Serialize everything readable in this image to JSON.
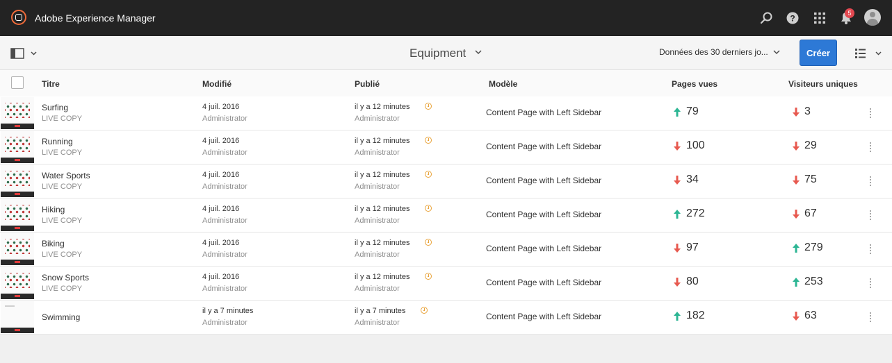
{
  "app": {
    "title": "Adobe Experience Manager",
    "notification_count": "5",
    "icons": [
      "aem-logo-icon",
      "search-icon",
      "help-icon",
      "apps-icon",
      "bell-icon",
      "avatar"
    ]
  },
  "toolbar": {
    "page_title": "Equipment",
    "date_range": "Données des 30 derniers jo...",
    "create_label": "Créer"
  },
  "columns": {
    "title": "Titre",
    "modified": "Modifié",
    "published": "Publié",
    "template": "Modèle",
    "page_views": "Pages vues",
    "unique_visitors": "Visiteurs uniques"
  },
  "colors": {
    "up": "#2db694",
    "down": "#e7594f",
    "accent": "#2d79d6",
    "pending": "#e9a33a"
  },
  "rows": [
    {
      "title": "Surfing",
      "subtitle": "LIVE COPY",
      "modified": "4 juil. 2016",
      "modified_by": "Administrator",
      "published": "il y a 12 minutes",
      "published_by": "Administrator",
      "template": "Content Page with Left Sidebar",
      "views": "79",
      "views_trend": "up",
      "visitors": "3",
      "visitors_trend": "down"
    },
    {
      "title": "Running",
      "subtitle": "LIVE COPY",
      "modified": "4 juil. 2016",
      "modified_by": "Administrator",
      "published": "il y a 12 minutes",
      "published_by": "Administrator",
      "template": "Content Page with Left Sidebar",
      "views": "100",
      "views_trend": "down",
      "visitors": "29",
      "visitors_trend": "down"
    },
    {
      "title": "Water Sports",
      "subtitle": "LIVE COPY",
      "modified": "4 juil. 2016",
      "modified_by": "Administrator",
      "published": "il y a 12 minutes",
      "published_by": "Administrator",
      "template": "Content Page with Left Sidebar",
      "views": "34",
      "views_trend": "down",
      "visitors": "75",
      "visitors_trend": "down"
    },
    {
      "title": "Hiking",
      "subtitle": "LIVE COPY",
      "modified": "4 juil. 2016",
      "modified_by": "Administrator",
      "published": "il y a 12 minutes",
      "published_by": "Administrator",
      "template": "Content Page with Left Sidebar",
      "views": "272",
      "views_trend": "up",
      "visitors": "67",
      "visitors_trend": "down"
    },
    {
      "title": "Biking",
      "subtitle": "LIVE COPY",
      "modified": "4 juil. 2016",
      "modified_by": "Administrator",
      "published": "il y a 12 minutes",
      "published_by": "Administrator",
      "template": "Content Page with Left Sidebar",
      "views": "97",
      "views_trend": "down",
      "visitors": "279",
      "visitors_trend": "up"
    },
    {
      "title": "Snow Sports",
      "subtitle": "LIVE COPY",
      "modified": "4 juil. 2016",
      "modified_by": "Administrator",
      "published": "il y a 12 minutes",
      "published_by": "Administrator",
      "template": "Content Page with Left Sidebar",
      "views": "80",
      "views_trend": "down",
      "visitors": "253",
      "visitors_trend": "up"
    },
    {
      "title": "Swimming",
      "subtitle": "",
      "modified": "il y a 7 minutes",
      "modified_by": "Administrator",
      "published": "il y a 7 minutes",
      "published_by": "Administrator",
      "template": "Content Page with Left Sidebar",
      "views": "182",
      "views_trend": "up",
      "visitors": "63",
      "visitors_trend": "down"
    }
  ]
}
